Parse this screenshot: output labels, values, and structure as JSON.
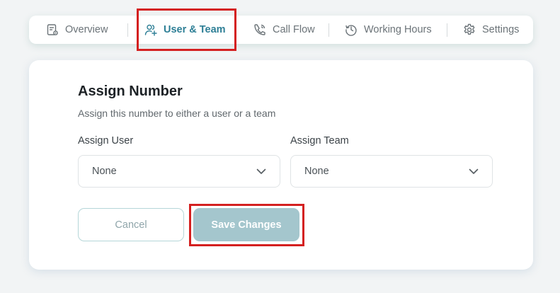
{
  "tabs": [
    {
      "label": "Overview",
      "icon": "overview-icon",
      "active": false
    },
    {
      "label": "User & Team",
      "icon": "user-team-icon",
      "active": true
    },
    {
      "label": "Call Flow",
      "icon": "phone-icon",
      "active": false
    },
    {
      "label": "Working Hours",
      "icon": "clock-icon",
      "active": false
    },
    {
      "label": "Settings",
      "icon": "gear-icon",
      "active": false
    }
  ],
  "card": {
    "title": "Assign Number",
    "subtitle": "Assign this number to either a user or a team",
    "assign_user": {
      "label": "Assign User",
      "value": "None"
    },
    "assign_team": {
      "label": "Assign Team",
      "value": "None"
    }
  },
  "buttons": {
    "cancel": "Cancel",
    "save": "Save Changes"
  },
  "colors": {
    "accent": "#2e7f96",
    "save_button": "#a4c6cd",
    "highlight": "#d42020",
    "page_background": "#f2f4f5"
  }
}
